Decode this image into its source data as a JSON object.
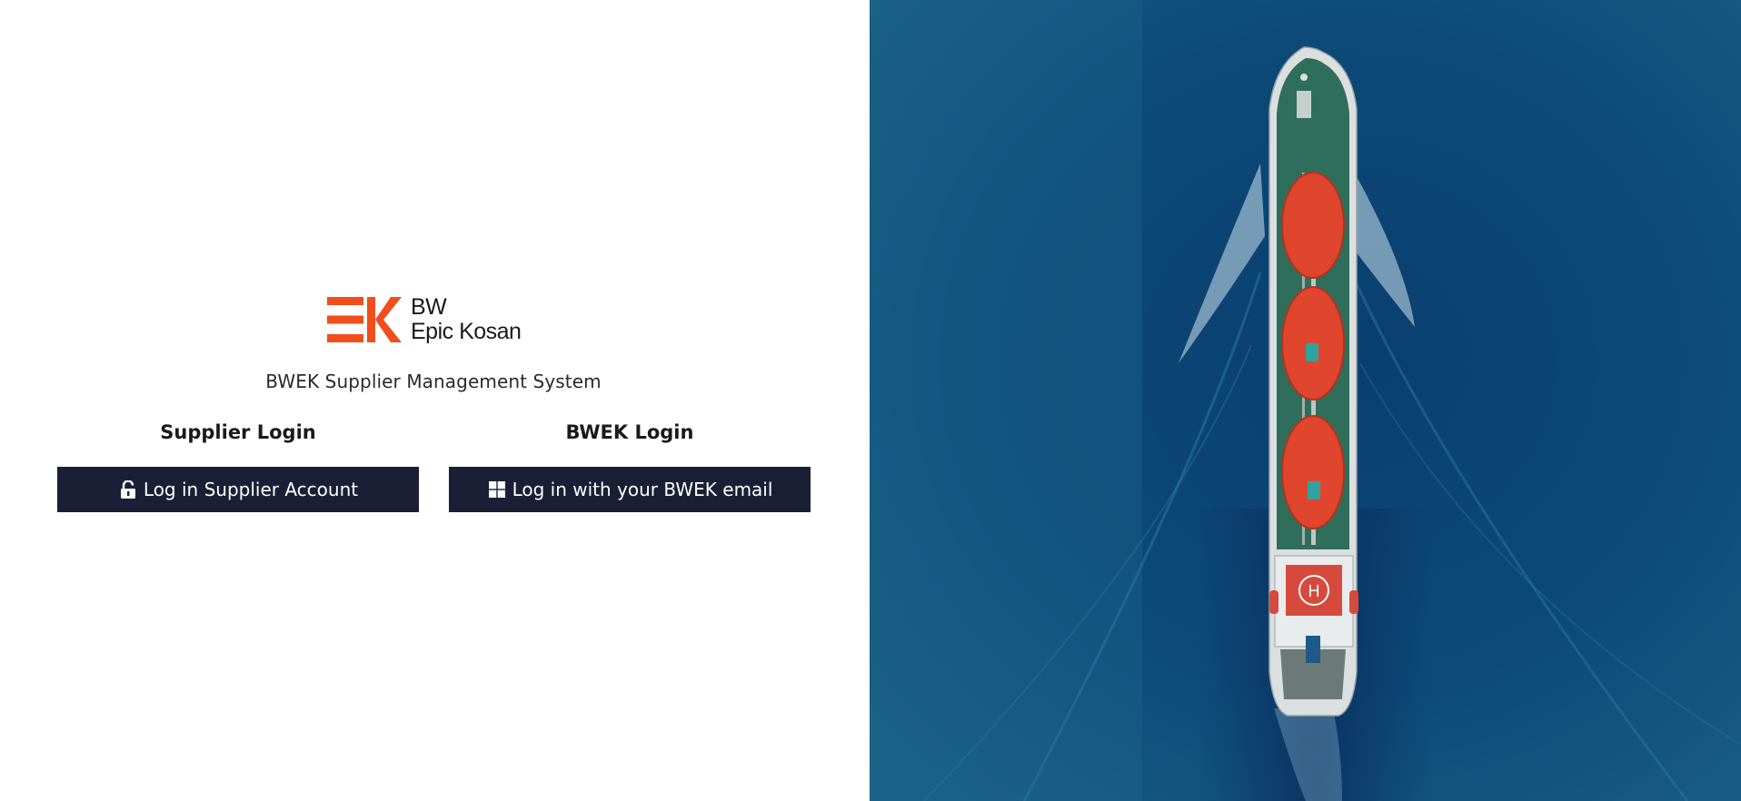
{
  "logo": {
    "line1": "BW",
    "line2": "Epic Kosan",
    "accent_color": "#f04e1c"
  },
  "subtitle": "BWEK Supplier Management System",
  "supplier_login": {
    "heading": "Supplier Login",
    "button_label": "Log in Supplier Account",
    "icon": "lock-open-icon"
  },
  "bwek_login": {
    "heading": "BWEK Login",
    "button_label": "Log in with your BWEK email",
    "icon": "windows-icon"
  },
  "colors": {
    "button_bg": "#1b1f36",
    "sea": "#0d4a75",
    "hull_deck": "#2f6e5a",
    "tanks": "#e0452d"
  }
}
